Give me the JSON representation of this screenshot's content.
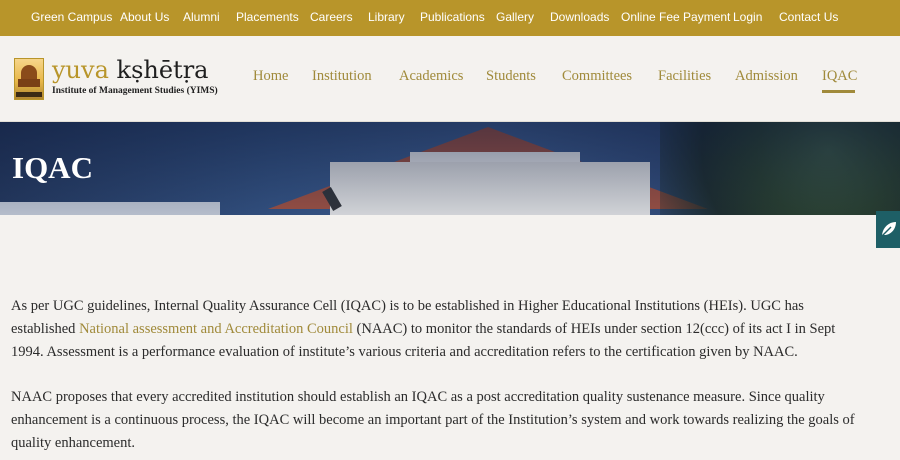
{
  "topbar": {
    "items": [
      "Green Campus",
      "About Us",
      "Alumni",
      "Placements",
      "Careers",
      "Library",
      "Publications",
      "Gallery",
      "Downloads",
      "Online Fee Payment",
      "Login",
      "Contact Us"
    ]
  },
  "logo": {
    "title_part1": "yuva",
    "title_part2": "kṣhētṛa",
    "subtitle": "Institute of Management Studies (YIMS)"
  },
  "nav": {
    "items": [
      "Home",
      "Institution",
      "Academics",
      "Students",
      "Committees",
      "Facilities",
      "Admission",
      "IQAC"
    ],
    "active": "IQAC"
  },
  "banner": {
    "title": "IQAC"
  },
  "side_button": {
    "icon": "leaf-icon"
  },
  "content": {
    "p1_before_link": "As per UGC guidelines, Internal Quality Assurance Cell (IQAC) is to be established in Higher Educational Institutions (HEIs). UGC has established ",
    "p1_link": "National assessment and Accreditation Council",
    "p1_after_link": " (NAAC) to monitor the standards of HEIs under section 12(ccc) of its act I in Sept 1994. Assessment is a performance evaluation of institute’s various criteria and accreditation refers to the certification given by NAAC.",
    "p2": "NAAC proposes that every accredited institution should establish an IQAC as a post accreditation quality sustenance measure. Since quality enhancement is a continuous process, the IQAC will become an important part of the Institution’s system and work towards realizing the goals of quality enhancement."
  },
  "colors": {
    "topbar_bg": "#b8952a",
    "accent_gold": "#a08a3a",
    "page_bg": "#f4f2ef",
    "side_button_bg": "#1e5f66"
  }
}
